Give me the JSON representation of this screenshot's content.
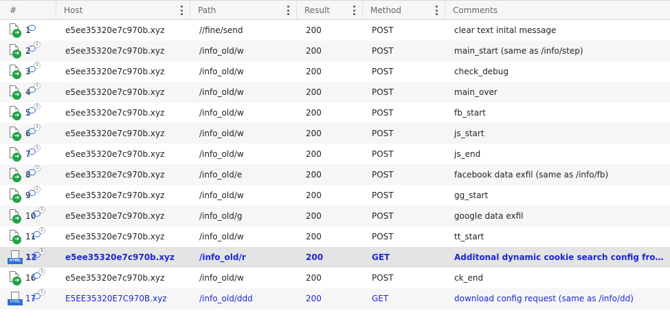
{
  "columns": [
    "#",
    "Host",
    "Path",
    "Result",
    "Method",
    "Comments"
  ],
  "rows": [
    {
      "num": "1",
      "host": "e5ee35320e7c970b.xyz",
      "path": "//fine/send",
      "result": "200",
      "method": "POST",
      "comment": "clear text inital message",
      "icon": "document-arrow-icon",
      "badge": ""
    },
    {
      "num": "2",
      "host": "e5ee35320e7c970b.xyz",
      "path": "/info_old/w",
      "result": "200",
      "method": "POST",
      "comment": "main_start (same as /info/step)",
      "icon": "document-arrow-icon",
      "badge": "1"
    },
    {
      "num": "3",
      "host": "e5ee35320e7c970b.xyz",
      "path": "/info_old/w",
      "result": "200",
      "method": "POST",
      "comment": "check_debug",
      "icon": "document-arrow-icon",
      "badge": "1"
    },
    {
      "num": "4",
      "host": "e5ee35320e7c970b.xyz",
      "path": "/info_old/w",
      "result": "200",
      "method": "POST",
      "comment": "main_over",
      "icon": "document-arrow-icon",
      "badge": "1"
    },
    {
      "num": "5",
      "host": "e5ee35320e7c970b.xyz",
      "path": "/info_old/w",
      "result": "200",
      "method": "POST",
      "comment": "fb_start",
      "icon": "document-arrow-icon",
      "badge": "1"
    },
    {
      "num": "6",
      "host": "e5ee35320e7c970b.xyz",
      "path": "/info_old/w",
      "result": "200",
      "method": "POST",
      "comment": "js_start",
      "icon": "document-arrow-icon",
      "badge": "1"
    },
    {
      "num": "7",
      "host": "e5ee35320e7c970b.xyz",
      "path": "/info_old/w",
      "result": "200",
      "method": "POST",
      "comment": "js_end",
      "icon": "document-arrow-icon",
      "badge": "1"
    },
    {
      "num": "8",
      "host": "e5ee35320e7c970b.xyz",
      "path": "/info_old/e",
      "result": "200",
      "method": "POST",
      "comment": "facebook data exfil (same as /info/fb)",
      "icon": "document-arrow-icon",
      "badge": "1"
    },
    {
      "num": "9",
      "host": "e5ee35320e7c970b.xyz",
      "path": "/info_old/w",
      "result": "200",
      "method": "POST",
      "comment": "gg_start",
      "icon": "document-arrow-icon",
      "badge": "1"
    },
    {
      "num": "10",
      "host": "e5ee35320e7c970b.xyz",
      "path": "/info_old/g",
      "result": "200",
      "method": "POST",
      "comment": "google data exfil",
      "icon": "document-arrow-icon",
      "badge": "1"
    },
    {
      "num": "11",
      "host": "e5ee35320e7c970b.xyz",
      "path": "/info_old/w",
      "result": "200",
      "method": "POST",
      "comment": "tt_start",
      "icon": "document-arrow-icon",
      "badge": "1"
    },
    {
      "num": "12",
      "host": "e5ee35320e7c970b.xyz",
      "path": "/info_old/r",
      "result": "200",
      "method": "GET",
      "comment": "Additonal dynamic cookie search config from server?",
      "icon": "html-document-icon",
      "badge": "1"
    },
    {
      "num": "16",
      "host": "e5ee35320e7c970b.xyz",
      "path": "/info_old/w",
      "result": "200",
      "method": "POST",
      "comment": "ck_end",
      "icon": "document-arrow-icon",
      "badge": "1"
    },
    {
      "num": "17",
      "host": "E5EE35320E7C970B.xyz",
      "path": "/info_old/ddd",
      "result": "200",
      "method": "GET",
      "comment": "download config request (same as /info/dd)",
      "icon": "html-document-icon",
      "badge": "1"
    }
  ],
  "icon_labels": {
    "html_tag": "HTML"
  },
  "colors": {
    "link_blue": "#1c25d6",
    "selected_row": "#e4e4e4",
    "alt_row": "#f6f6f6",
    "arrow_green": "#1fa245",
    "bubble_blue": "#2f6fd6"
  }
}
